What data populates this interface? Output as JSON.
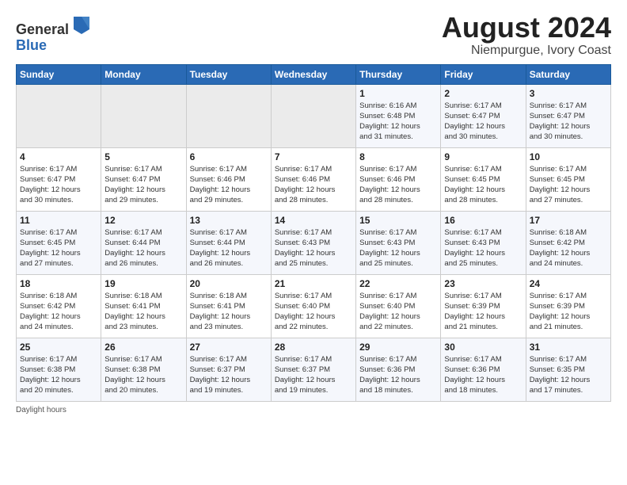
{
  "header": {
    "logo_general": "General",
    "logo_blue": "Blue",
    "month_title": "August 2024",
    "location": "Niempurgue, Ivory Coast"
  },
  "days_of_week": [
    "Sunday",
    "Monday",
    "Tuesday",
    "Wednesday",
    "Thursday",
    "Friday",
    "Saturday"
  ],
  "weeks": [
    [
      {
        "num": "",
        "info": ""
      },
      {
        "num": "",
        "info": ""
      },
      {
        "num": "",
        "info": ""
      },
      {
        "num": "",
        "info": ""
      },
      {
        "num": "1",
        "info": "Sunrise: 6:16 AM\nSunset: 6:48 PM\nDaylight: 12 hours\nand 31 minutes."
      },
      {
        "num": "2",
        "info": "Sunrise: 6:17 AM\nSunset: 6:47 PM\nDaylight: 12 hours\nand 30 minutes."
      },
      {
        "num": "3",
        "info": "Sunrise: 6:17 AM\nSunset: 6:47 PM\nDaylight: 12 hours\nand 30 minutes."
      }
    ],
    [
      {
        "num": "4",
        "info": "Sunrise: 6:17 AM\nSunset: 6:47 PM\nDaylight: 12 hours\nand 30 minutes."
      },
      {
        "num": "5",
        "info": "Sunrise: 6:17 AM\nSunset: 6:47 PM\nDaylight: 12 hours\nand 29 minutes."
      },
      {
        "num": "6",
        "info": "Sunrise: 6:17 AM\nSunset: 6:46 PM\nDaylight: 12 hours\nand 29 minutes."
      },
      {
        "num": "7",
        "info": "Sunrise: 6:17 AM\nSunset: 6:46 PM\nDaylight: 12 hours\nand 28 minutes."
      },
      {
        "num": "8",
        "info": "Sunrise: 6:17 AM\nSunset: 6:46 PM\nDaylight: 12 hours\nand 28 minutes."
      },
      {
        "num": "9",
        "info": "Sunrise: 6:17 AM\nSunset: 6:45 PM\nDaylight: 12 hours\nand 28 minutes."
      },
      {
        "num": "10",
        "info": "Sunrise: 6:17 AM\nSunset: 6:45 PM\nDaylight: 12 hours\nand 27 minutes."
      }
    ],
    [
      {
        "num": "11",
        "info": "Sunrise: 6:17 AM\nSunset: 6:45 PM\nDaylight: 12 hours\nand 27 minutes."
      },
      {
        "num": "12",
        "info": "Sunrise: 6:17 AM\nSunset: 6:44 PM\nDaylight: 12 hours\nand 26 minutes."
      },
      {
        "num": "13",
        "info": "Sunrise: 6:17 AM\nSunset: 6:44 PM\nDaylight: 12 hours\nand 26 minutes."
      },
      {
        "num": "14",
        "info": "Sunrise: 6:17 AM\nSunset: 6:43 PM\nDaylight: 12 hours\nand 25 minutes."
      },
      {
        "num": "15",
        "info": "Sunrise: 6:17 AM\nSunset: 6:43 PM\nDaylight: 12 hours\nand 25 minutes."
      },
      {
        "num": "16",
        "info": "Sunrise: 6:17 AM\nSunset: 6:43 PM\nDaylight: 12 hours\nand 25 minutes."
      },
      {
        "num": "17",
        "info": "Sunrise: 6:18 AM\nSunset: 6:42 PM\nDaylight: 12 hours\nand 24 minutes."
      }
    ],
    [
      {
        "num": "18",
        "info": "Sunrise: 6:18 AM\nSunset: 6:42 PM\nDaylight: 12 hours\nand 24 minutes."
      },
      {
        "num": "19",
        "info": "Sunrise: 6:18 AM\nSunset: 6:41 PM\nDaylight: 12 hours\nand 23 minutes."
      },
      {
        "num": "20",
        "info": "Sunrise: 6:18 AM\nSunset: 6:41 PM\nDaylight: 12 hours\nand 23 minutes."
      },
      {
        "num": "21",
        "info": "Sunrise: 6:17 AM\nSunset: 6:40 PM\nDaylight: 12 hours\nand 22 minutes."
      },
      {
        "num": "22",
        "info": "Sunrise: 6:17 AM\nSunset: 6:40 PM\nDaylight: 12 hours\nand 22 minutes."
      },
      {
        "num": "23",
        "info": "Sunrise: 6:17 AM\nSunset: 6:39 PM\nDaylight: 12 hours\nand 21 minutes."
      },
      {
        "num": "24",
        "info": "Sunrise: 6:17 AM\nSunset: 6:39 PM\nDaylight: 12 hours\nand 21 minutes."
      }
    ],
    [
      {
        "num": "25",
        "info": "Sunrise: 6:17 AM\nSunset: 6:38 PM\nDaylight: 12 hours\nand 20 minutes."
      },
      {
        "num": "26",
        "info": "Sunrise: 6:17 AM\nSunset: 6:38 PM\nDaylight: 12 hours\nand 20 minutes."
      },
      {
        "num": "27",
        "info": "Sunrise: 6:17 AM\nSunset: 6:37 PM\nDaylight: 12 hours\nand 19 minutes."
      },
      {
        "num": "28",
        "info": "Sunrise: 6:17 AM\nSunset: 6:37 PM\nDaylight: 12 hours\nand 19 minutes."
      },
      {
        "num": "29",
        "info": "Sunrise: 6:17 AM\nSunset: 6:36 PM\nDaylight: 12 hours\nand 18 minutes."
      },
      {
        "num": "30",
        "info": "Sunrise: 6:17 AM\nSunset: 6:36 PM\nDaylight: 12 hours\nand 18 minutes."
      },
      {
        "num": "31",
        "info": "Sunrise: 6:17 AM\nSunset: 6:35 PM\nDaylight: 12 hours\nand 17 minutes."
      }
    ]
  ],
  "footer": {
    "text": "Daylight hours"
  }
}
